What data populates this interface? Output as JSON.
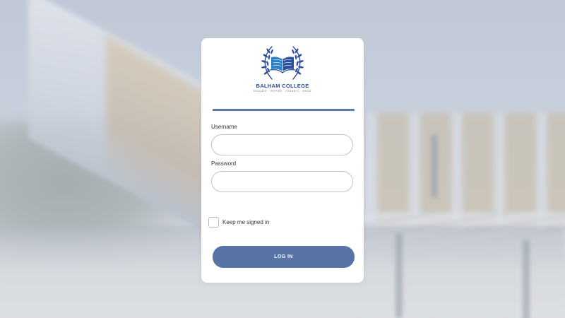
{
  "brand": {
    "name": "BALHAM COLLEGE",
    "tagline": "EDUCATE . INSPIRE . CONNECT . GROW",
    "accent_color": "#2a4f9c",
    "logo_icon": "open-book-laurel-icon"
  },
  "form": {
    "username_label": "Username",
    "username_value": "",
    "password_label": "Password",
    "password_value": "",
    "remember_label": "Keep me signed in",
    "remember_checked": false,
    "submit_label": "LOG IN",
    "button_color": "#5874a6"
  }
}
